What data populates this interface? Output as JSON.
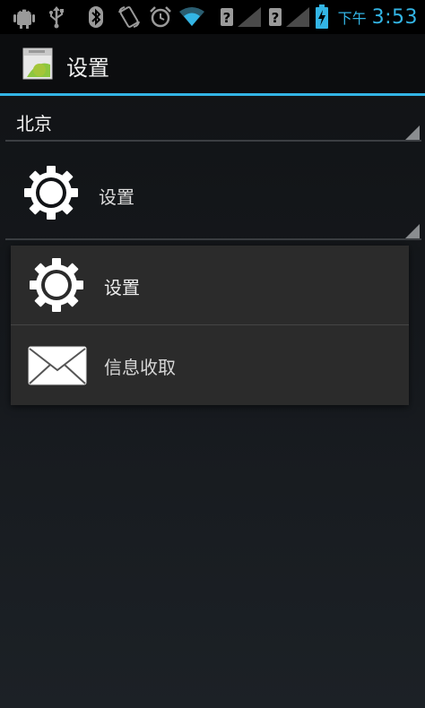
{
  "status_bar": {
    "period": "下午",
    "time": "3:53",
    "icons": [
      "android-debug-icon",
      "usb-icon",
      "bluetooth-icon",
      "rotate-icon",
      "alarm-icon",
      "wifi-icon",
      "signal-no-sim-icon",
      "signal-no-sim-icon",
      "battery-charging-icon"
    ],
    "accent_color": "#33b5e5"
  },
  "action_bar": {
    "title": "设置",
    "icon": "android-app-icon"
  },
  "spinner_city": {
    "value": "北京"
  },
  "spinner_item": {
    "label": "设置",
    "icon": "gear-icon"
  },
  "dropdown": {
    "items": [
      {
        "label": "设置",
        "icon": "gear-icon"
      },
      {
        "label": "信息收取",
        "icon": "envelope-icon"
      }
    ]
  }
}
